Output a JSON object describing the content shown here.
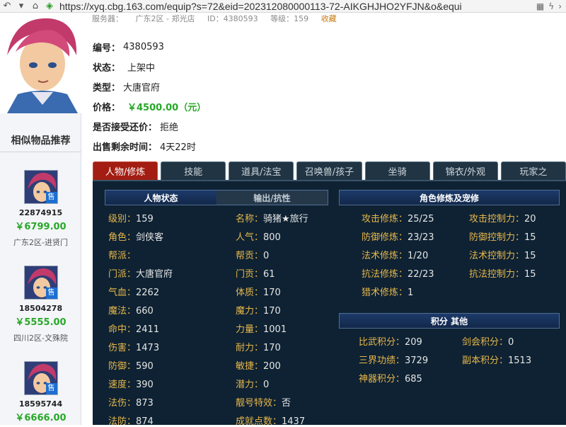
{
  "browser": {
    "url": "https://xyq.cbg.163.com/equip?s=72&eid=202312080000113-72-AIKGHJHO2YFJN&o&equi"
  },
  "site_strip": [
    "服务器：",
    "广东2区 - 郑光店",
    "ID：4380593",
    "等级：159",
    "收藏"
  ],
  "sidebar": {
    "title": "相似物品推荐",
    "badge": "售",
    "items": [
      {
        "id": "22874915",
        "price": "￥6799.00",
        "server": "广东2区-进贤门"
      },
      {
        "id": "18504278",
        "price": "￥5555.00",
        "server": "四川2区-文殊院"
      },
      {
        "id": "18595744",
        "price": "￥6666.00",
        "server": ""
      }
    ]
  },
  "info": {
    "id_label": "编号：",
    "id_value": "4380593",
    "status_label": "状态：",
    "status_value": "上架中",
    "type_label": "类型：",
    "type_value": "大唐官府",
    "price_label": "价格：",
    "price_value": "￥4500.00（元）",
    "bargain_label": "是否接受还价：",
    "bargain_value": "拒绝",
    "time_label": "出售剩余时间：",
    "time_value": "4天22时"
  },
  "tabs": [
    "人物/修炼",
    "技能",
    "道具/法宝",
    "召唤兽/孩子",
    "坐骑",
    "锦衣/外观",
    "玩家之"
  ],
  "panel": {
    "heads": {
      "role_status": "人物状态",
      "output_resist": "输出/抗性",
      "cultivation": "角色修炼及宠修",
      "points": "积分 其他"
    },
    "left_col": [
      {
        "label": "级别：",
        "value": "159"
      },
      {
        "label": "角色：",
        "value": "剑侠客"
      },
      {
        "label": "帮派：",
        "value": ""
      },
      {
        "label": "门派：",
        "value": "大唐官府"
      },
      {
        "label": "气血：",
        "value": "2262"
      },
      {
        "label": "魔法：",
        "value": "660"
      },
      {
        "label": "命中：",
        "value": "2411"
      },
      {
        "label": "伤害：",
        "value": "1473"
      },
      {
        "label": "防御：",
        "value": "590"
      },
      {
        "label": "速度：",
        "value": "390"
      },
      {
        "label": "法伤：",
        "value": "873"
      },
      {
        "label": "法防：",
        "value": "874"
      }
    ],
    "mid_col": [
      {
        "label": "名称：",
        "value": "骑猪★旅行"
      },
      {
        "label": "人气：",
        "value": "800"
      },
      {
        "label": "帮贡：",
        "value": "0"
      },
      {
        "label": "门贡：",
        "value": "61"
      },
      {
        "label": "体质：",
        "value": "170"
      },
      {
        "label": "魔力：",
        "value": "170"
      },
      {
        "label": "力量：",
        "value": "1001"
      },
      {
        "label": "耐力：",
        "value": "170"
      },
      {
        "label": "敏捷：",
        "value": "200"
      },
      {
        "label": "潜力：",
        "value": "0"
      },
      {
        "label": "靓号特效：",
        "value": "否"
      },
      {
        "label": "成就点数：",
        "value": "1437"
      }
    ],
    "cult_left": [
      {
        "label": "攻击修炼：",
        "value": "25/25"
      },
      {
        "label": "防御修炼：",
        "value": "23/23"
      },
      {
        "label": "法术修炼：",
        "value": "1/20"
      },
      {
        "label": "抗法修炼：",
        "value": "22/23"
      },
      {
        "label": "猎术修炼：",
        "value": "1"
      }
    ],
    "cult_right": [
      {
        "label": "攻击控制力：",
        "value": "20"
      },
      {
        "label": "防御控制力：",
        "value": "15"
      },
      {
        "label": "法术控制力：",
        "value": "15"
      },
      {
        "label": "抗法控制力：",
        "value": "15"
      }
    ],
    "points_left": [
      {
        "label": "比武积分：",
        "value": "209"
      },
      {
        "label": "三界功绩：",
        "value": "3729"
      },
      {
        "label": "神器积分：",
        "value": "685"
      }
    ],
    "points_right": [
      {
        "label": "剑会积分：",
        "value": "0"
      },
      {
        "label": "副本积分：",
        "value": "1513"
      }
    ]
  }
}
